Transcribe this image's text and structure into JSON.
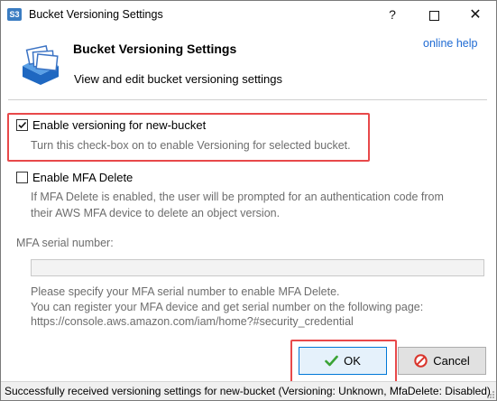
{
  "window": {
    "title": "Bucket Versioning Settings",
    "app_icon_text": "S3",
    "help_glyph": "?",
    "close_glyph": "✕"
  },
  "header": {
    "title": "Bucket Versioning Settings",
    "subtitle": "View and edit bucket versioning settings",
    "online_help": "online help"
  },
  "versioning": {
    "checked": true,
    "label": "Enable versioning for new-bucket",
    "hint": "Turn this check-box on to enable Versioning for selected bucket."
  },
  "mfa_delete": {
    "checked": false,
    "label": "Enable MFA Delete",
    "hint_line1": "If MFA Delete is enabled, the user will be prompted for an authentication code from",
    "hint_line2": "their AWS MFA device to delete an object version."
  },
  "mfa_serial": {
    "label": "MFA serial number:",
    "value": "",
    "info_line1": "Please specify your MFA serial number to enable MFA Delete.",
    "info_line2": "You can register your MFA device and get serial number on the following page:",
    "info_line3": "https://console.aws.amazon.com/iam/home?#security_credential"
  },
  "buttons": {
    "ok": "OK",
    "cancel": "Cancel"
  },
  "status_bar": "Successfully received versioning settings for new-bucket (Versioning: Unknown, MfaDelete: Disabled)",
  "colors": {
    "highlight": "#e8494a",
    "link": "#1e6ad3",
    "hint_text": "#6d6d6d"
  }
}
